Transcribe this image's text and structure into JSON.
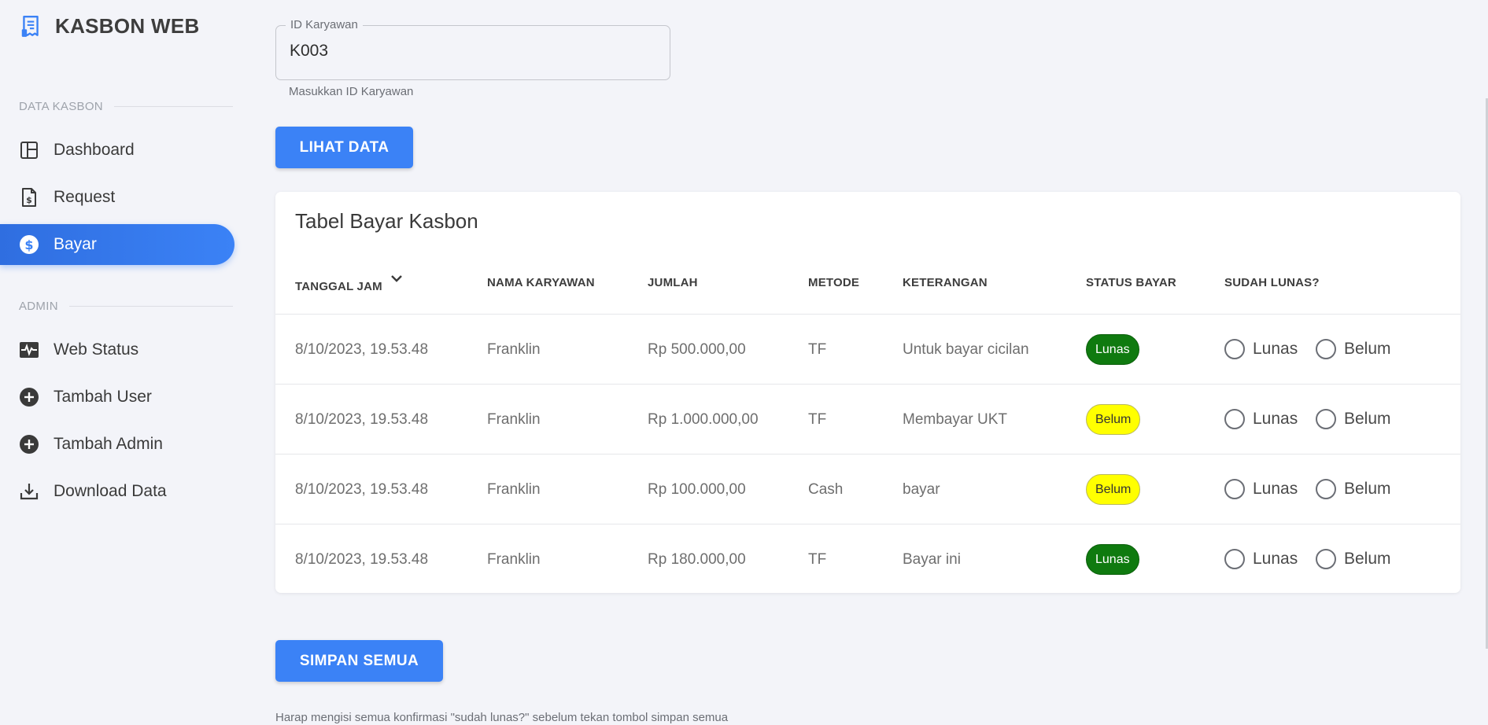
{
  "brand": {
    "name": "KASBON WEB",
    "icon": "receipt-icon"
  },
  "sidebar": {
    "section1": "DATA KASBON",
    "section2": "ADMIN",
    "items": [
      {
        "label": "Dashboard",
        "icon": "dashboard-icon"
      },
      {
        "label": "Request",
        "icon": "document-dollar-icon"
      },
      {
        "label": "Bayar",
        "icon": "dollar-circle-icon",
        "active": true
      },
      {
        "label": "Web Status",
        "icon": "pulse-icon"
      },
      {
        "label": "Tambah User",
        "icon": "plus-circle-icon"
      },
      {
        "label": "Tambah Admin",
        "icon": "plus-circle-icon"
      },
      {
        "label": "Download Data",
        "icon": "download-icon"
      }
    ]
  },
  "form": {
    "label": "ID Karyawan",
    "value": "K003",
    "helper": "Masukkan ID Karyawan",
    "button": "LIHAT DATA"
  },
  "table": {
    "title": "Tabel Bayar Kasbon",
    "headers": [
      "TANGGAL JAM",
      "NAMA KARYAWAN",
      "JUMLAH",
      "METODE",
      "KETERANGAN",
      "STATUS BAYAR",
      "SUDAH LUNAS?"
    ],
    "radio_labels": [
      "Lunas",
      "Belum"
    ],
    "rows": [
      {
        "tanggal": "8/10/2023, 19.53.48",
        "nama": "Franklin",
        "jumlah": "Rp 500.000,00",
        "metode": "TF",
        "keterangan": "Untuk bayar cicilan",
        "status": "Lunas"
      },
      {
        "tanggal": "8/10/2023, 19.53.48",
        "nama": "Franklin",
        "jumlah": "Rp 1.000.000,00",
        "metode": "TF",
        "keterangan": "Membayar UKT",
        "status": "Belum"
      },
      {
        "tanggal": "8/10/2023, 19.53.48",
        "nama": "Franklin",
        "jumlah": "Rp 100.000,00",
        "metode": "Cash",
        "keterangan": "bayar",
        "status": "Belum"
      },
      {
        "tanggal": "8/10/2023, 19.53.48",
        "nama": "Franklin",
        "jumlah": "Rp 180.000,00",
        "metode": "TF",
        "keterangan": "Bayar ini",
        "status": "Lunas"
      }
    ]
  },
  "footer": {
    "button": "SIMPAN SEMUA",
    "note": "Harap mengisi semua konfirmasi \"sudah lunas?\" sebelum tekan tombol simpan semua"
  },
  "colors": {
    "accent": "#3b82f6",
    "lunas": "#0f7a0f",
    "belum": "#ffff00",
    "background": "#f3f4f9"
  }
}
